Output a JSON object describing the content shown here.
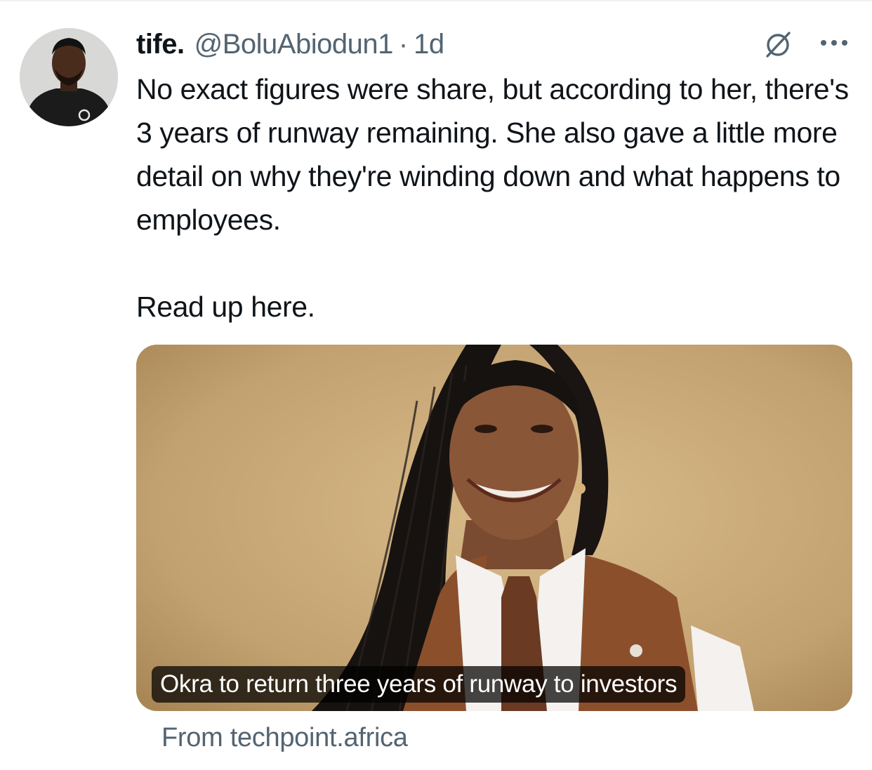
{
  "tweet": {
    "author": {
      "display_name": "tife.",
      "handle": "@BoluAbiodun1",
      "separator": "·",
      "time": "1d",
      "avatar_icon": "profile-photo"
    },
    "actions": {
      "grok_icon": "grok-icon",
      "more_icon": "more-horizontal-icon"
    },
    "text": {
      "paragraph_1": "No exact figures were share, but according to her, there's 3 years of runway remaining. She also gave a little more detail on why they're winding down and what happens to employees.",
      "paragraph_2": "Read up here."
    },
    "link_card": {
      "caption": "Okra to return three years of runway to investors",
      "source": "From techpoint.africa",
      "image_icon": "article-photo"
    }
  },
  "colors": {
    "text_primary": "#0f1419",
    "text_secondary": "#536471",
    "divider": "#eff3f4",
    "card_background": "#c7a878"
  }
}
